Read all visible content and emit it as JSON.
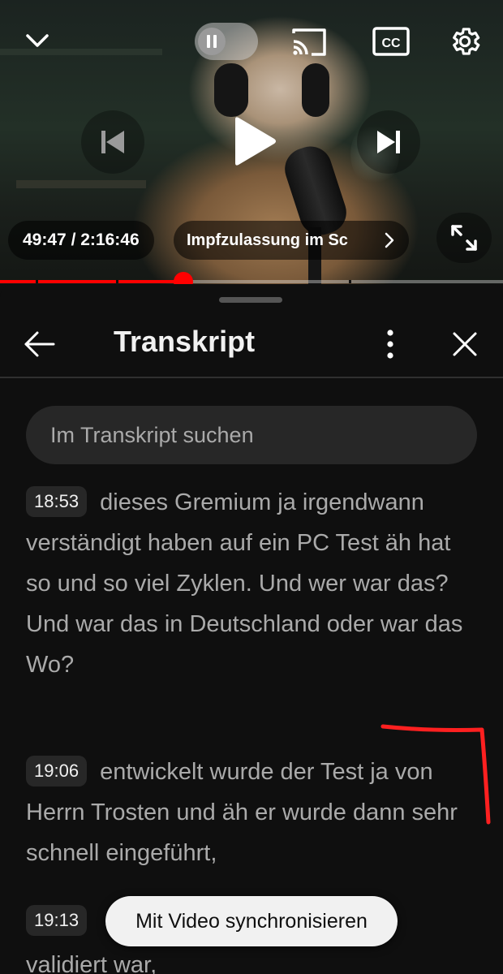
{
  "player": {
    "elapsed_time": "49:47",
    "time_separator": "/",
    "total_duration": "2:16:46",
    "chapter_title": "Impfzulassung im Sc",
    "progress_fraction": 0.364,
    "is_paused": true,
    "autoplay_enabled": false,
    "cc_label": "CC",
    "accent_color": "#ff0000"
  },
  "transcript": {
    "title": "Transkript",
    "search_placeholder": "Im Transkript suchen",
    "segments": [
      {
        "timestamp": "18:53",
        "text": "dieses Gremium ja irgendwann verständigt haben auf ein PC Test äh hat so und so viel Zyklen. Und wer war das? Und war das in Deutschland oder war das Wo?"
      },
      {
        "timestamp": "19:06",
        "text": "entwickelt wurde der Test ja von Herrn Trosten und äh er wurde dann sehr schnell eingeführt,"
      },
      {
        "timestamp": "19:13",
        "text": "validiert war,"
      }
    ],
    "sync_button_label": "Mit Video synchronisieren"
  },
  "annotation": {
    "color": "#ff2020"
  }
}
